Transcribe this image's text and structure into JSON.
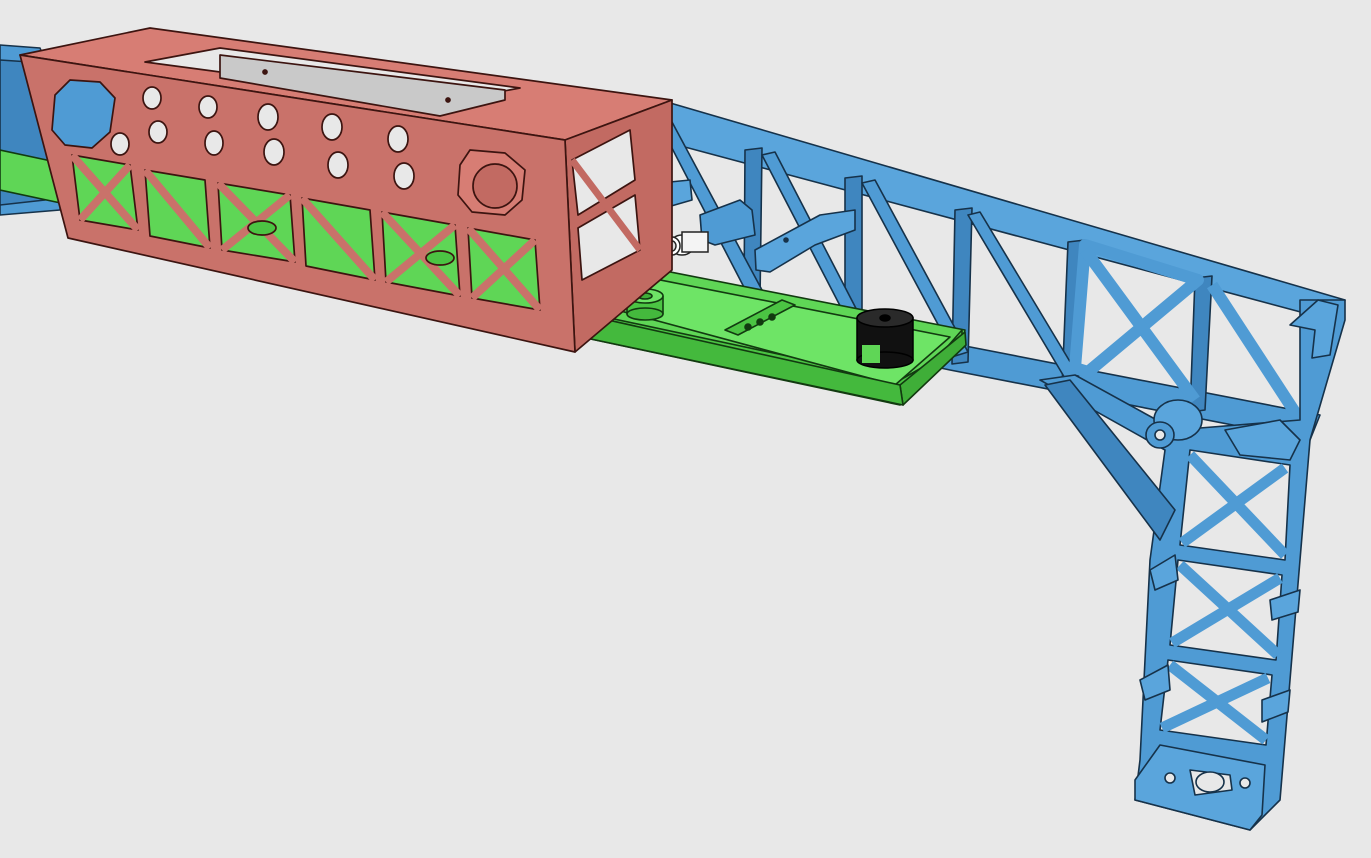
{
  "scene": {
    "kind": "3d-cad-viewport",
    "background": "#e8e8e8",
    "parts": [
      {
        "name": "red-housing",
        "color": "#d77d74"
      },
      {
        "name": "blue-truss-arm",
        "color": "#4f9bd4"
      },
      {
        "name": "green-tray",
        "color": "#5fd656"
      },
      {
        "name": "grey-rail",
        "color": "#c9c9c9"
      },
      {
        "name": "black-cylinder",
        "color": "#111111"
      },
      {
        "name": "white-fitting",
        "color": "#ffffff"
      }
    ]
  }
}
